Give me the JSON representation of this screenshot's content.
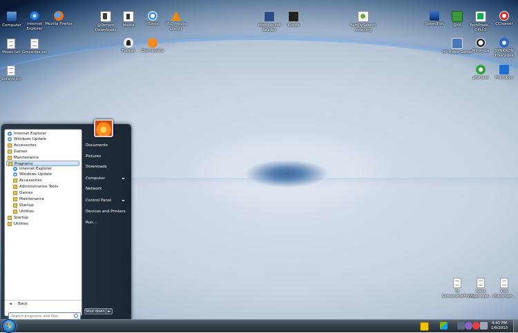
{
  "desktop_icons": [
    {
      "label": "Computer"
    },
    {
      "label": "Internet Explorer"
    },
    {
      "label": "Mozilla Firefox"
    },
    {
      "label": "@Torrent Downloads"
    },
    {
      "label": "Media"
    },
    {
      "label": "iTunes"
    },
    {
      "label": "VLC media player"
    },
    {
      "label": "Mobipocket Reader"
    },
    {
      "label": "Kindle"
    },
    {
      "label": "FamilySearch Indexing"
    },
    {
      "label": "SpeedFan"
    },
    {
      "label": "SIW"
    },
    {
      "label": "TechPowe... GPU-Z"
    },
    {
      "label": "CCleaner"
    },
    {
      "label": "Foobar"
    },
    {
      "label": "Clementine"
    },
    {
      "label": "Meals.txt"
    },
    {
      "label": "Groceries.txt"
    },
    {
      "label": "Sprays.txt"
    },
    {
      "label": "HP Video Sense"
    },
    {
      "label": "Miromba"
    },
    {
      "label": "SYNKRON FreeSides"
    },
    {
      "label": "µTorrent"
    },
    {
      "label": "Photobox"
    },
    {
      "label": "To ScreenshotForm..."
    },
    {
      "label": "Kaila Videocapt..."
    },
    {
      "label": "Kalt Videocapt..."
    }
  ],
  "start_menu": {
    "programs": [
      {
        "label": "Internet Explorer"
      },
      {
        "label": "Windows Update"
      },
      {
        "label": "Accessories"
      },
      {
        "label": "Games"
      },
      {
        "label": "Maintenance"
      },
      {
        "label": "Programs"
      },
      {
        "label": "Internet Explorer"
      },
      {
        "label": "Windows Update"
      },
      {
        "label": "Accessories"
      },
      {
        "label": "Administrative Tools"
      },
      {
        "label": "Games"
      },
      {
        "label": "Maintenance"
      },
      {
        "label": "Startup"
      },
      {
        "label": "Utilities"
      },
      {
        "label": "Startup"
      },
      {
        "label": "Utilities"
      }
    ],
    "back_label": "Back",
    "search_placeholder": "Search programs and files",
    "right_items": [
      {
        "label": "Documents"
      },
      {
        "label": "Pictures"
      },
      {
        "label": "Downloads"
      },
      {
        "label": "Computer",
        "submenu": "►"
      },
      {
        "label": "Network"
      },
      {
        "label": "Control Panel",
        "submenu": "►"
      },
      {
        "label": "Devices and Printers"
      },
      {
        "label": "Run..."
      }
    ],
    "shutdown_label": "Shut down",
    "shutdown_arrow": "►"
  },
  "taskbar": {
    "clock_time": "4:41 PM",
    "clock_date": "1/8/2013"
  }
}
